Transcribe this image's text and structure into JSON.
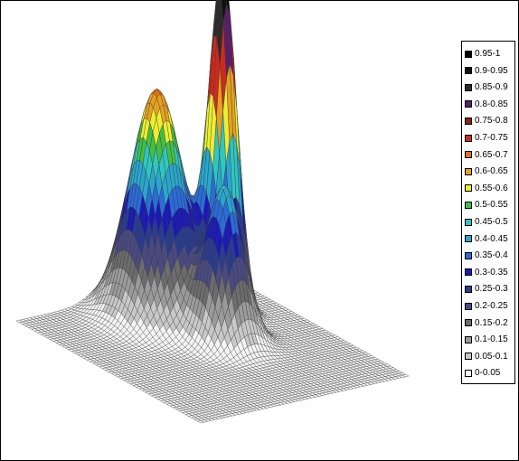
{
  "chart_data": {
    "type": "surface",
    "title": "",
    "xlabel": "",
    "ylabel": "",
    "zlabel": "",
    "zlim": [
      0,
      1
    ],
    "grid": false,
    "legend_position": "right",
    "surface_peaks": [
      {
        "name": "",
        "height": 0.67,
        "spread": 0.1
      },
      {
        "name": "",
        "height": 0.45,
        "spread": 0.07
      },
      {
        "name": "",
        "height": 1.0,
        "spread": 0.05
      }
    ],
    "legend": [
      {
        "label": "0.95-1",
        "color": "#000000"
      },
      {
        "label": "0.9-0.95",
        "color": "#111111"
      },
      {
        "label": "0.85-0.9",
        "color": "#2b2b2b"
      },
      {
        "label": "0.8-0.85",
        "color": "#5a1f6a"
      },
      {
        "label": "0.75-0.8",
        "color": "#8b2410"
      },
      {
        "label": "0.7-0.75",
        "color": "#cc2a1c"
      },
      {
        "label": "0.65-0.7",
        "color": "#e06f17"
      },
      {
        "label": "0.6-0.65",
        "color": "#e6a020"
      },
      {
        "label": "0.55-0.6",
        "color": "#eeee30"
      },
      {
        "label": "0.5-0.55",
        "color": "#44c040"
      },
      {
        "label": "0.45-0.5",
        "color": "#30c6c0"
      },
      {
        "label": "0.4-0.45",
        "color": "#2aa6cc"
      },
      {
        "label": "0.35-0.4",
        "color": "#2a6cd8"
      },
      {
        "label": "0.3-0.35",
        "color": "#1a1ab8"
      },
      {
        "label": "0.25-0.3",
        "color": "#2a3c90"
      },
      {
        "label": "0.2-0.25",
        "color": "#4a4a82"
      },
      {
        "label": "0.15-0.2",
        "color": "#6c6c6c"
      },
      {
        "label": "0.1-0.15",
        "color": "#9a9a9a"
      },
      {
        "label": "0.05-0.1",
        "color": "#c8c8c8"
      },
      {
        "label": "0-0.05",
        "color": "#f4f4f4"
      }
    ]
  }
}
